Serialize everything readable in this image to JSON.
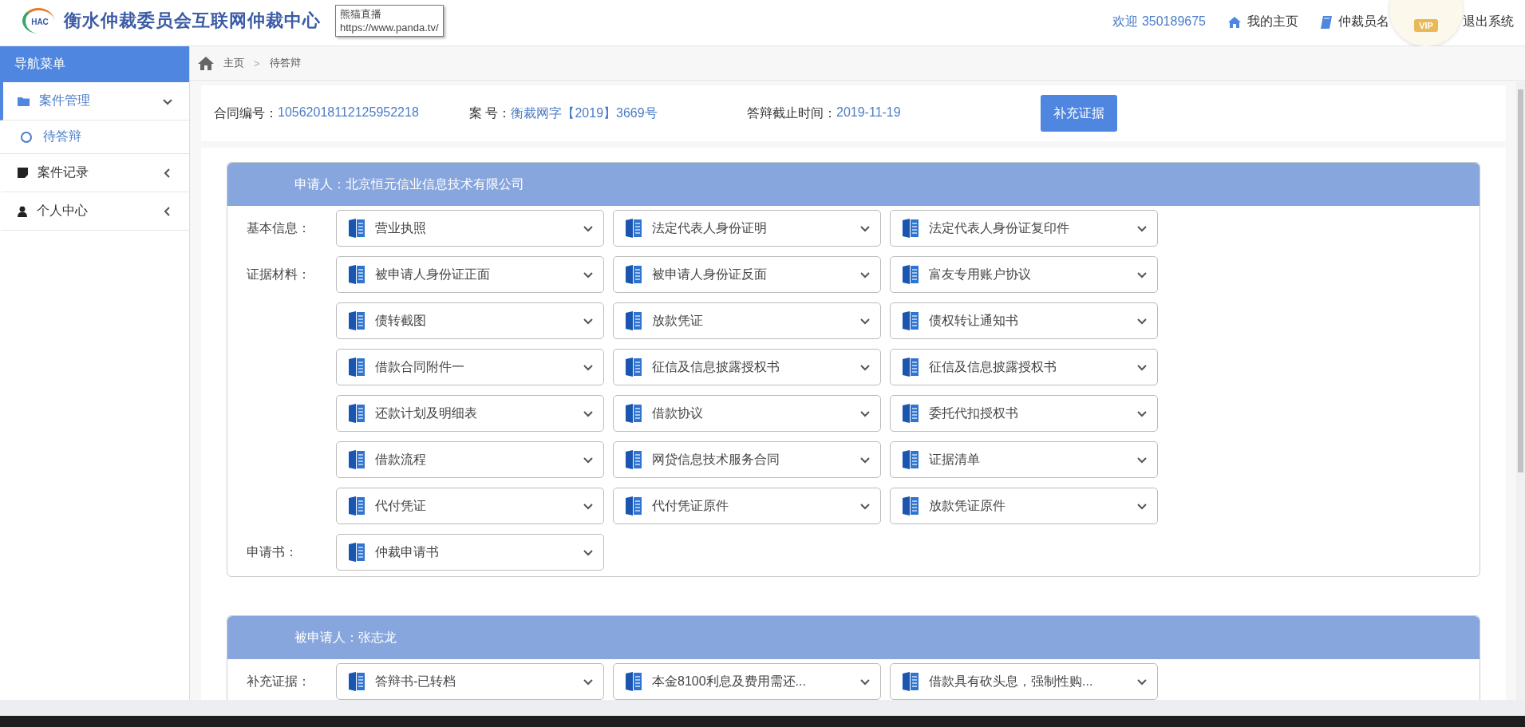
{
  "header": {
    "logo_text": "HAC",
    "title": "衡水仲裁委员会互联网仲裁中心",
    "welcome": "欢迎 350189675",
    "nav": [
      {
        "label": "我的主页"
      },
      {
        "label": "仲裁员名"
      },
      {
        "label": "退出系统"
      }
    ],
    "vip_badge": "VIP"
  },
  "tooltip": {
    "title": "熊猫直播",
    "url": "https://www.panda.tv/"
  },
  "sidebar": {
    "title": "导航菜单",
    "items": [
      {
        "label": "案件管理",
        "expanded": true,
        "children": [
          {
            "label": "待答辩",
            "selected": true
          }
        ]
      },
      {
        "label": "案件记录",
        "expanded": false
      },
      {
        "label": "个人中心",
        "expanded": false
      }
    ]
  },
  "breadcrumb": {
    "items": [
      "主页",
      "待答辩"
    ],
    "separator": ">"
  },
  "case_info": {
    "fields": [
      {
        "label": "合同编号：",
        "value": "10562018112125952218"
      },
      {
        "label": "案 号：",
        "value": "衡裁网字【2019】3669号"
      },
      {
        "label": "答辩截止时间：",
        "value": "2019-11-19"
      }
    ],
    "button": "补充证据"
  },
  "sections": [
    {
      "title": "申请人：北京恒元信业信息技术有限公司",
      "groups": [
        {
          "label": "基本信息：",
          "files": [
            "营业执照",
            "法定代表人身份证明",
            "法定代表人身份证复印件"
          ]
        },
        {
          "label": "证据材料：",
          "files": [
            "被申请人身份证正面",
            "被申请人身份证反面",
            "富友专用账户协议",
            "债转截图",
            "放款凭证",
            "债权转让通知书",
            "借款合同附件一",
            "征信及信息披露授权书",
            "征信及信息披露授权书",
            "还款计划及明细表",
            "借款协议",
            "委托代扣授权书",
            "借款流程",
            "网贷信息技术服务合同",
            "证据清单",
            "代付凭证",
            "代付凭证原件",
            "放款凭证原件"
          ]
        },
        {
          "label": "申请书：",
          "files": [
            "仲裁申请书"
          ]
        }
      ]
    },
    {
      "title": "被申请人：张志龙",
      "groups": [
        {
          "label": "补充证据：",
          "files": [
            "答辩书-已转档",
            "本金8100利息及费用需还...",
            "借款具有砍头息，强制性购..."
          ]
        }
      ]
    }
  ]
}
